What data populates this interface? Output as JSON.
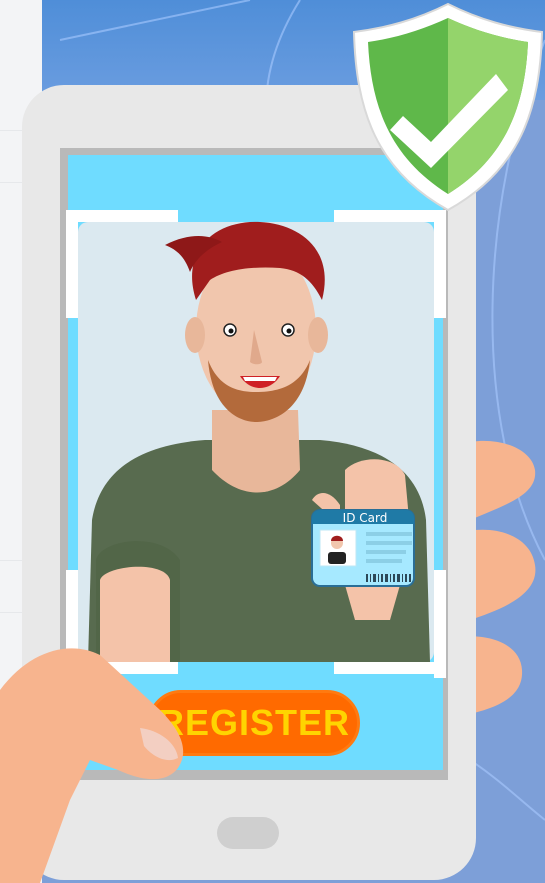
{
  "register_button": {
    "label": "REGISTER"
  },
  "id_card": {
    "title": "ID Card"
  },
  "colors": {
    "phone_screen": "#6fdcff",
    "button": "#ff6a00",
    "button_text": "#ffd400",
    "shield_green": "#5fb84a",
    "background": "#7d9fd8"
  },
  "icons": [
    "shield-check-icon"
  ]
}
